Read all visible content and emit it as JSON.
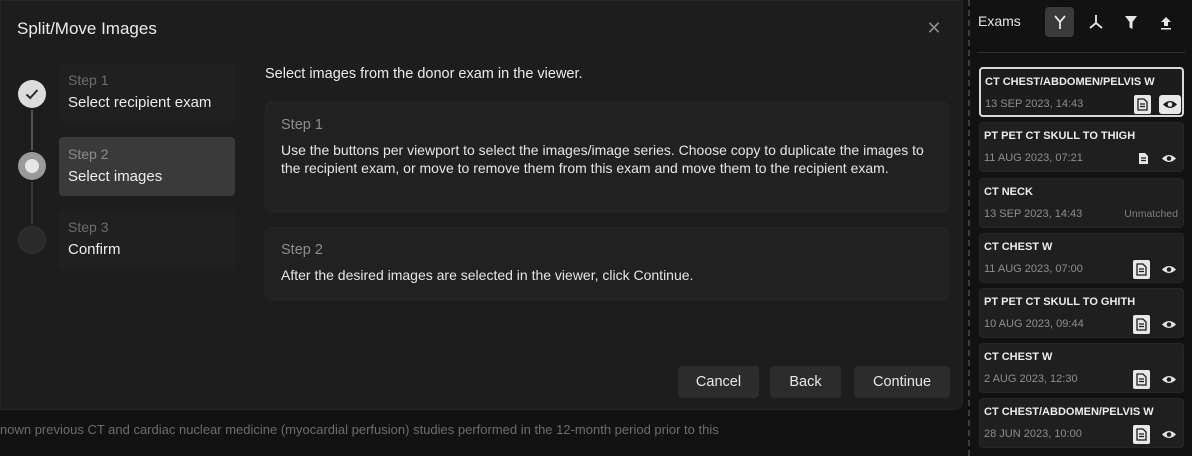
{
  "background_text": "nown previous CT and cardiac nuclear medicine (myocardial perfusion) studies performed in the 12-month period prior to this",
  "dialog": {
    "title": "Split/Move Images",
    "close_glyph": "✕",
    "steps": [
      {
        "number": "Step 1",
        "label": "Select recipient exam",
        "state": "done"
      },
      {
        "number": "Step 2",
        "label": "Select images",
        "state": "active"
      },
      {
        "number": "Step 3",
        "label": "Confirm",
        "state": "todo"
      }
    ],
    "instruction": "Select images from the donor exam in the viewer.",
    "boxes": [
      {
        "title": "Step 1",
        "body": "Use the buttons per viewport to select the images/image series.  Choose copy to duplicate the images to the recipient exam, or move to remove them from this exam and move them to the recipient exam."
      },
      {
        "title": "Step 2",
        "body": "After the desired images are selected in the viewer, click Continue."
      }
    ],
    "buttons": {
      "cancel": "Cancel",
      "back": "Back",
      "continue": "Continue"
    }
  },
  "exams_panel": {
    "title": "Exams",
    "tools": [
      "split-merge-icon",
      "split-down-icon",
      "filter-icon",
      "upload-icon"
    ],
    "exams": [
      {
        "title": "CT CHEST/ABDOMEN/PELVIS W",
        "date": "13 SEP 2023, 14:43",
        "status": "",
        "selected": true,
        "doc": "filled",
        "eye": "boxed"
      },
      {
        "title": "PT PET CT SKULL TO THIGH",
        "date": "11 AUG 2023, 07:21",
        "status": "",
        "selected": false,
        "doc": "plain",
        "eye": "plain"
      },
      {
        "title": "CT NECK",
        "date": "13 SEP 2023, 14:43",
        "status": "Unmatched",
        "selected": false,
        "doc": "none",
        "eye": "none"
      },
      {
        "title": "CT CHEST W",
        "date": "11 AUG 2023, 07:00",
        "status": "",
        "selected": false,
        "doc": "filled",
        "eye": "plain"
      },
      {
        "title": "PT PET CT SKULL TO GHITH",
        "date": "10 AUG 2023, 09:44",
        "status": "",
        "selected": false,
        "doc": "filled",
        "eye": "plain"
      },
      {
        "title": "CT CHEST W",
        "date": "2 AUG 2023, 12:30",
        "status": "",
        "selected": false,
        "doc": "filled",
        "eye": "plain"
      },
      {
        "title": "CT CHEST/ABDOMEN/PELVIS W",
        "date": "28 JUN 2023, 10:00",
        "status": "",
        "selected": false,
        "doc": "filled",
        "eye": "plain"
      }
    ]
  }
}
